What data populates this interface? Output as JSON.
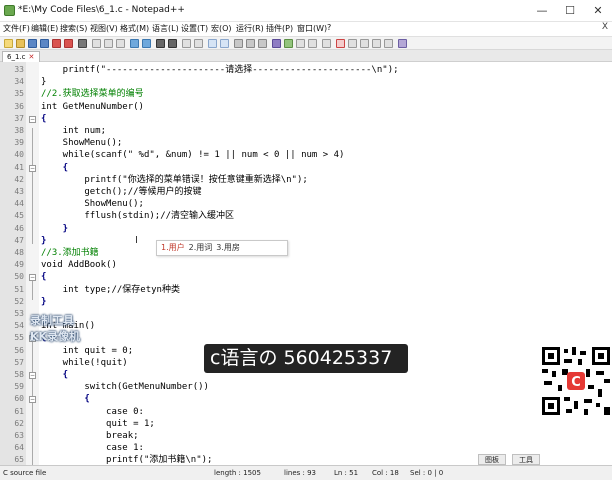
{
  "window": {
    "title": "*E:\\My Code Files\\6_1.c - Notepad++",
    "minimize": "—",
    "maximize": "☐",
    "close": "✕"
  },
  "menubar": {
    "items": [
      "文件(F)",
      "编辑(E)",
      "搜索(S)",
      "视图(V)",
      "格式(M)",
      "语言(L)",
      "设置(T)",
      "宏(O)",
      "运行(R)",
      "插件(P)",
      "窗口(W)",
      "?"
    ],
    "close": "X"
  },
  "tab": {
    "label": "6_1.c",
    "close": "✕"
  },
  "code_lines": [
    {
      "n": "33",
      "text": "    printf(\"----------------------请选择----------------------\\n\");"
    },
    {
      "n": "34",
      "text": "}"
    },
    {
      "n": "35",
      "text": "//2.获取选择菜单的编号"
    },
    {
      "n": "36",
      "text": "int GetMenuNumber()"
    },
    {
      "n": "37",
      "text": "{"
    },
    {
      "n": "38",
      "text": "    int num;"
    },
    {
      "n": "39",
      "text": "    ShowMenu();"
    },
    {
      "n": "40",
      "text": "    while(scanf(\" %d\", &num) != 1 || num < 0 || num > 4)"
    },
    {
      "n": "41",
      "text": "    {"
    },
    {
      "n": "42",
      "text": "        printf(\"你选择的菜单错误！按任意键重新选择\\n\");"
    },
    {
      "n": "43",
      "text": "        getch();//等候用户的按键"
    },
    {
      "n": "44",
      "text": "        ShowMenu();"
    },
    {
      "n": "45",
      "text": "        fflush(stdin);//清空输入缓冲区"
    },
    {
      "n": "46",
      "text": "    }"
    },
    {
      "n": "47",
      "text": "}"
    },
    {
      "n": "48",
      "text": "//3.添加书籍"
    },
    {
      "n": "49",
      "text": "void AddBook()"
    },
    {
      "n": "50",
      "text": "{"
    },
    {
      "n": "51",
      "text": "    int type;//保存etyn种类"
    },
    {
      "n": "52",
      "text": "}"
    },
    {
      "n": "53",
      "text": ""
    },
    {
      "n": "54",
      "text": "int main()"
    },
    {
      "n": "55",
      "text": "{"
    },
    {
      "n": "56",
      "text": "    int quit = 0;"
    },
    {
      "n": "57",
      "text": "    while(!quit)"
    },
    {
      "n": "58",
      "text": "    {"
    },
    {
      "n": "59",
      "text": "        switch(GetMenuNumber())"
    },
    {
      "n": "60",
      "text": "        {"
    },
    {
      "n": "61",
      "text": "            case 0:"
    },
    {
      "n": "62",
      "text": "            quit = 1;"
    },
    {
      "n": "63",
      "text": "            break;"
    },
    {
      "n": "64",
      "text": "            case 1:"
    },
    {
      "n": "65",
      "text": "            printf(\"添加书籍\\n\");"
    }
  ],
  "ime": {
    "option1": "1.用户",
    "option2": "2.用词",
    "option3": "3.用房"
  },
  "watermark": {
    "line1": "录制工具",
    "line2": "KK录像机",
    "channel": "c语言の 560425337"
  },
  "statusbar": {
    "filetype": "C source file",
    "length": "length : 1505",
    "lines": "lines : 93",
    "ln": "Ln : 51",
    "col": "Col : 18",
    "sel": "Sel : 0 | 0"
  },
  "taskbar": {
    "item1": "图板",
    "item2": "工具"
  },
  "colors": {
    "keyword": "#0000ff",
    "comment": "#008000",
    "number": "#ff8000",
    "string": "#808080",
    "gutter": "#e4e4e4"
  }
}
